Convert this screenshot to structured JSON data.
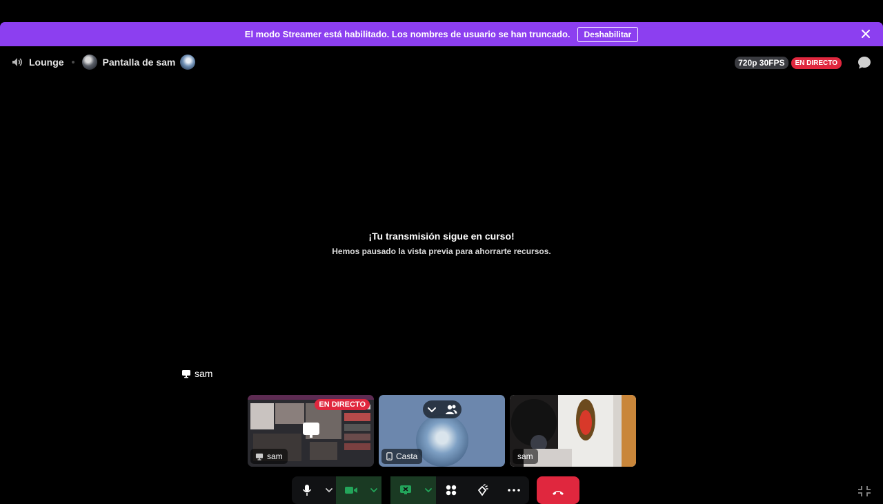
{
  "banner": {
    "text": "El modo Streamer está habilitado. Los nombres de usuario se han truncado.",
    "button_label": "Deshabilitar"
  },
  "header": {
    "channel_name": "Lounge",
    "stream_title": "Pantalla de sam",
    "quality": "720p 30FPS",
    "live_badge": "EN DIRECTO"
  },
  "main": {
    "title": "¡Tu transmisión sigue en curso!",
    "subtitle": "Hemos pausado la vista previa para ahorrarte recursos."
  },
  "focused_user": "sam",
  "tiles": [
    {
      "name": "sam",
      "badge": "EN DIRECTO",
      "kind": "screen"
    },
    {
      "name": "Casta",
      "kind": "mobile"
    },
    {
      "name": "sam",
      "kind": "camera"
    }
  ],
  "colors": {
    "banner": "#8c3ff0",
    "live": "#e0273e",
    "green": "#23a55a"
  },
  "icons": [
    "speaker-icon",
    "close-icon",
    "chat-icon",
    "screen-icon",
    "phone-icon",
    "mic-icon",
    "camera-icon",
    "screenshare-icon",
    "activities-icon",
    "soundboard-icon",
    "more-icon",
    "hangup-icon",
    "fullscreen-exit-icon"
  ]
}
